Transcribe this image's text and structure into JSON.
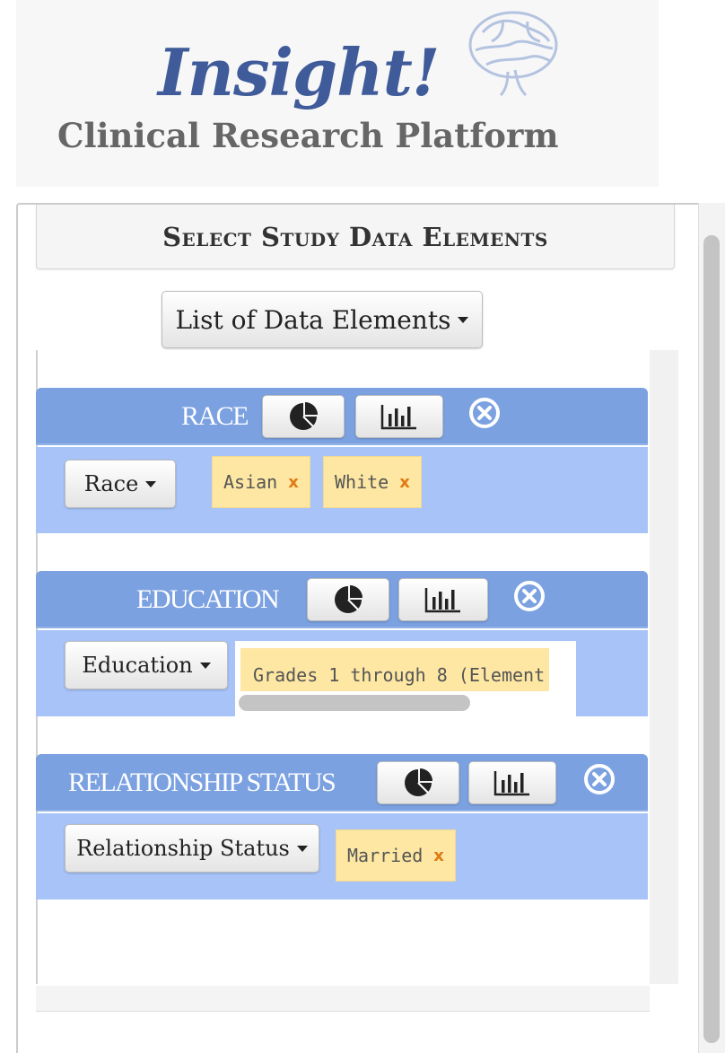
{
  "app": {
    "brand_title": "Insight!",
    "brand_subtitle": "Clinical Research Platform"
  },
  "panel": {
    "heading": "Select Study Data Elements",
    "list_button_label": "List of Data Elements"
  },
  "colors": {
    "brand_blue": "#3f5b9a",
    "block_header": "#7ba1e1",
    "block_body": "#a7c3f8",
    "tag_background": "#fde7a3",
    "tag_remove": "#e07a14"
  },
  "icons": {
    "pie_chart": "pie-chart-icon",
    "bar_chart": "bar-chart-icon",
    "remove": "close-circle-icon",
    "dropdown": "caret-down-icon",
    "logo": "brain-icon"
  },
  "data_elements": [
    {
      "title": "RACE",
      "dropdown_label": "Race",
      "selected_values": [
        {
          "label": "Asian",
          "remove": "x"
        },
        {
          "label": "White",
          "remove": "x"
        }
      ]
    },
    {
      "title": "EDUCATION",
      "dropdown_label": "Education",
      "selected_values": [
        {
          "label": "Grades 1 through 8 (Element"
        }
      ]
    },
    {
      "title": "RELATIONSHIP STATUS",
      "dropdown_label": "Relationship Status",
      "selected_values": [
        {
          "label": "Married",
          "remove": "x"
        }
      ]
    }
  ]
}
